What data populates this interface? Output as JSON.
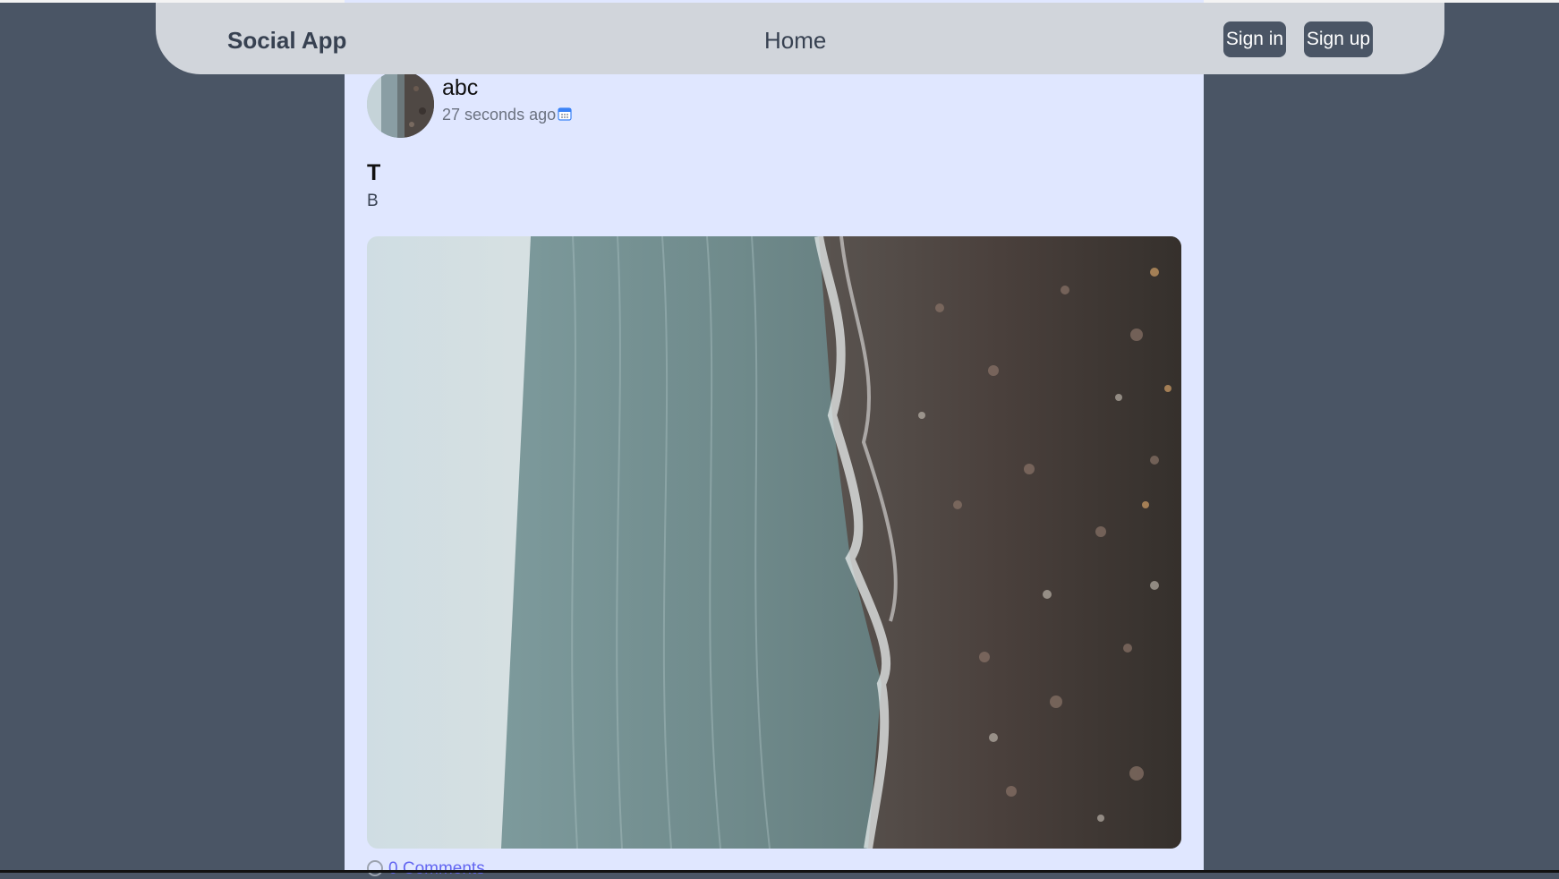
{
  "navbar": {
    "brand": "Social App",
    "home_link": "Home",
    "signin_label": "Sign in",
    "signup_label": "Sign up"
  },
  "post": {
    "author": "abc",
    "timestamp": "27 seconds ago",
    "title": "T",
    "body": "B",
    "comments_link": "0 Comments"
  },
  "colors": {
    "page_background": "#4a5565",
    "navbar_background": "#d1d5db",
    "card_background": "#e0e7ff",
    "button_background": "#4a5565",
    "link_color": "#6366f1"
  },
  "icons": {
    "calendar": "calendar-icon",
    "comment": "comment-icon"
  }
}
